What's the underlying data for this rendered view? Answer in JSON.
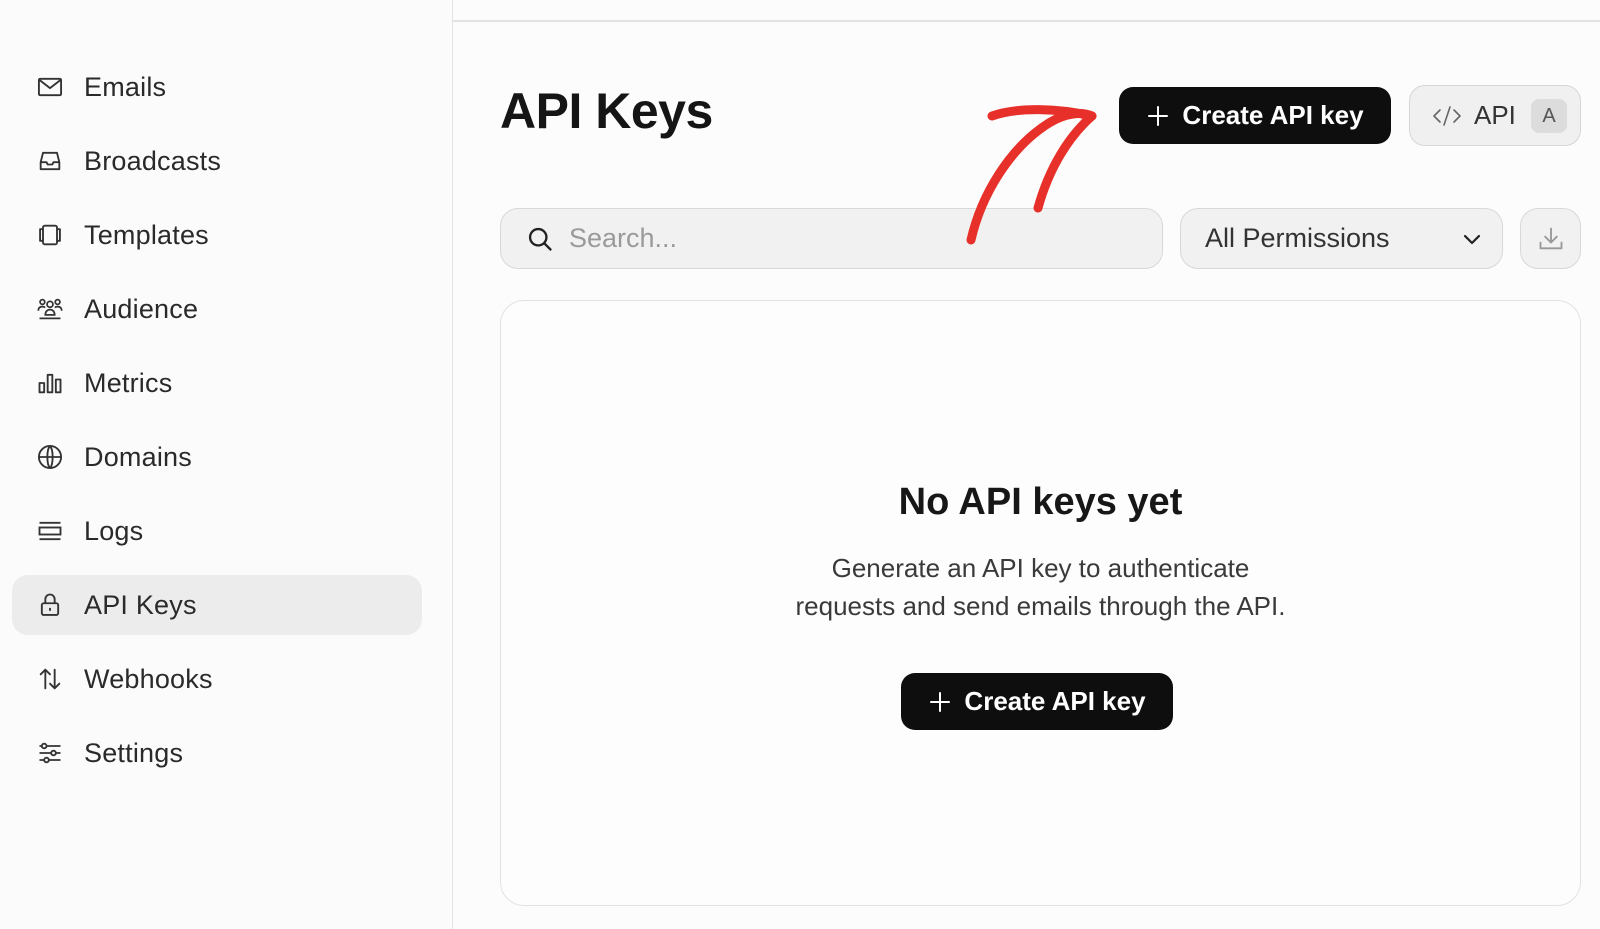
{
  "sidebar": {
    "items": [
      {
        "label": "Emails",
        "icon": "mail-icon"
      },
      {
        "label": "Broadcasts",
        "icon": "inbox-icon"
      },
      {
        "label": "Templates",
        "icon": "templates-icon"
      },
      {
        "label": "Audience",
        "icon": "users-icon"
      },
      {
        "label": "Metrics",
        "icon": "bar-chart-icon"
      },
      {
        "label": "Domains",
        "icon": "globe-icon"
      },
      {
        "label": "Logs",
        "icon": "logs-icon"
      },
      {
        "label": "API Keys",
        "icon": "lock-icon",
        "active": true
      },
      {
        "label": "Webhooks",
        "icon": "arrows-up-down-icon"
      },
      {
        "label": "Settings",
        "icon": "sliders-icon"
      }
    ]
  },
  "header": {
    "title": "API Keys",
    "create_button": "Create API key",
    "api_button": "API",
    "avatar_initial": "A"
  },
  "filters": {
    "search_placeholder": "Search...",
    "permissions_selected": "All Permissions"
  },
  "empty_state": {
    "title": "No API keys yet",
    "description_line1": "Generate an API key to authenticate",
    "description_line2": "requests and send emails through the API.",
    "create_button": "Create API key"
  },
  "colors": {
    "primary_button": "#0e0e0e",
    "annotation_arrow": "#e8302a",
    "active_nav": "#ececec"
  }
}
